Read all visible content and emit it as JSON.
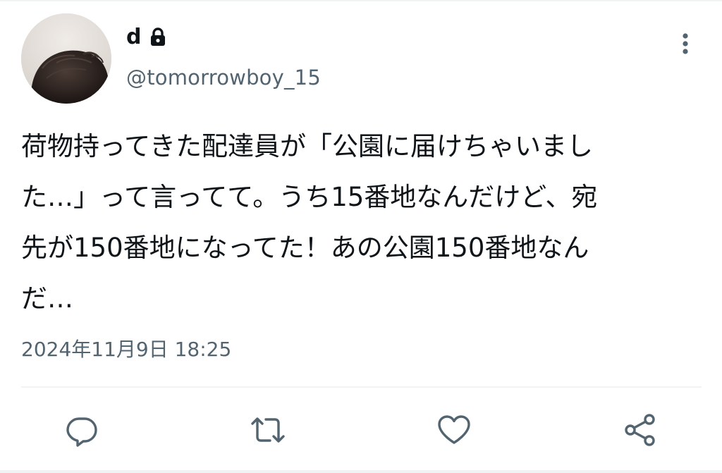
{
  "tweet": {
    "author": {
      "display_name": "d",
      "handle": "@tomorrowboy_15",
      "protected_icon": "lock-icon",
      "avatar": "profile-photo"
    },
    "menu_icon": "more-vertical-icon",
    "text_lines": [
      "荷物持ってきた配達員が「公園に届けちゃいまし",
      "た…」って言ってて。うち15番地なんだけど、宛",
      "先が150番地になってた！あの公園150番地なん",
      "だ…"
    ],
    "timestamp": "2024年11月9日 18:25",
    "actions": [
      {
        "name": "reply",
        "icon": "reply-icon"
      },
      {
        "name": "retweet",
        "icon": "retweet-icon"
      },
      {
        "name": "like",
        "icon": "heart-icon"
      },
      {
        "name": "share",
        "icon": "share-icon"
      }
    ],
    "colors": {
      "text_primary": "#0f1419",
      "text_secondary": "#536471",
      "divider": "#eff3f4",
      "icon": "#536471"
    }
  }
}
